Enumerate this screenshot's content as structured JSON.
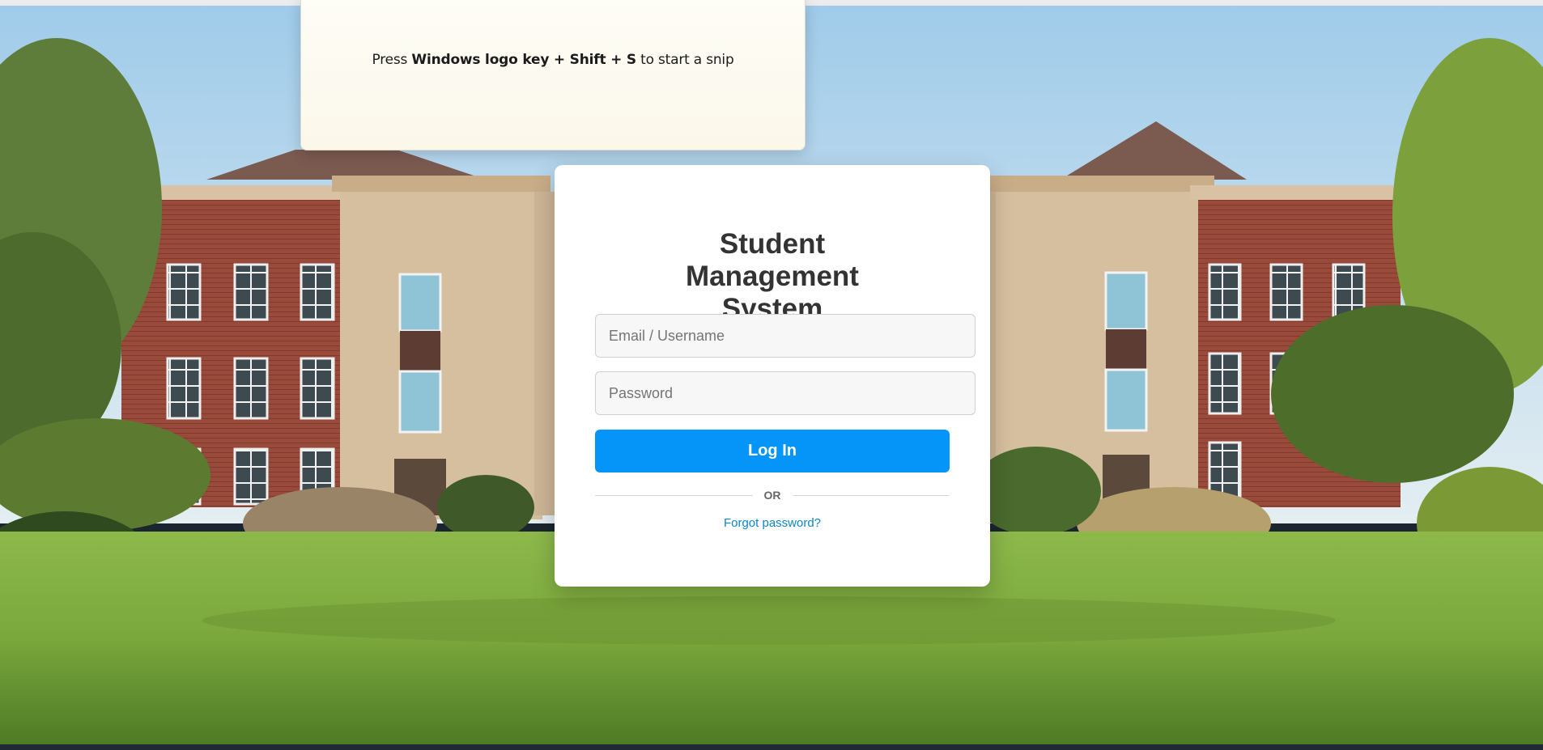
{
  "snip_notice": {
    "prefix": "Press ",
    "shortcut": "Windows logo key + Shift + S",
    "suffix": " to start a snip"
  },
  "login": {
    "title": "Student Management System",
    "email_placeholder": "Email / Username",
    "password_placeholder": "Password",
    "login_label": "Log In",
    "divider_label": "OR",
    "forgot_label": "Forgot password?"
  },
  "colors": {
    "primary_button": "#0594f7",
    "link": "#0a86c8",
    "title": "#333333"
  }
}
